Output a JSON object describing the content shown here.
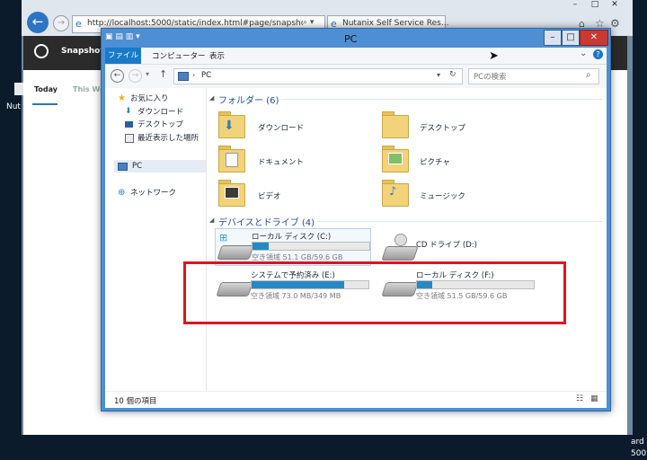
{
  "browser": {
    "url": "http://localhost:5000/static/index.html#page/snapshc",
    "tab_title": "Nutanix Self Service Res...",
    "app_title": "Snapshots",
    "tab_today": "Today",
    "tab_this_week": "This We",
    "side_text": "Nut",
    "corner_text1": "ard",
    "corner_text2": "500"
  },
  "window": {
    "title": "PC",
    "min": "–",
    "max": "□",
    "close": "✕"
  },
  "ribbon": {
    "file": "ファイル",
    "computer": "コンピューター",
    "view": "表示",
    "chevron": "⌄",
    "help": "?"
  },
  "address": {
    "back": "←",
    "forward": "→",
    "up": "↑",
    "location": "PC",
    "refresh": "↻",
    "search_placeholder": "PCの検索"
  },
  "nav": {
    "favorites": "お気に入り",
    "fav_items": [
      "ダウンロード",
      "デスクトップ",
      "最近表示した場所"
    ],
    "pc": "PC",
    "network": "ネットワーク"
  },
  "folders_header": "フォルダー (6)",
  "folders": [
    {
      "name": "ダウンロード"
    },
    {
      "name": "デスクトップ"
    },
    {
      "name": "ドキュメント"
    },
    {
      "name": "ピクチャ"
    },
    {
      "name": "ビデオ"
    },
    {
      "name": "ミュージック"
    }
  ],
  "drives_header": "デバイスとドライブ (4)",
  "drives": [
    {
      "name": "ローカル ディスク (C:)",
      "free": "空き領域 51.1 GB/59.6 GB",
      "used_fraction": 0.14
    },
    {
      "name": "CD ドライブ (D:)",
      "free": ""
    },
    {
      "name": "システムで予約済み (E:)",
      "free": "空き領域 73.0 MB/349 MB",
      "used_fraction": 0.79
    },
    {
      "name": "ローカル ディスク (F:)",
      "free": "空き領域 51.5 GB/59.6 GB",
      "used_fraction": 0.13
    }
  ],
  "status": {
    "count": "10 個の項目"
  },
  "colors": {
    "highlight_box": "#e0141b",
    "drive_fill": "#2688c5",
    "title_bar": "#4e8fd4"
  }
}
